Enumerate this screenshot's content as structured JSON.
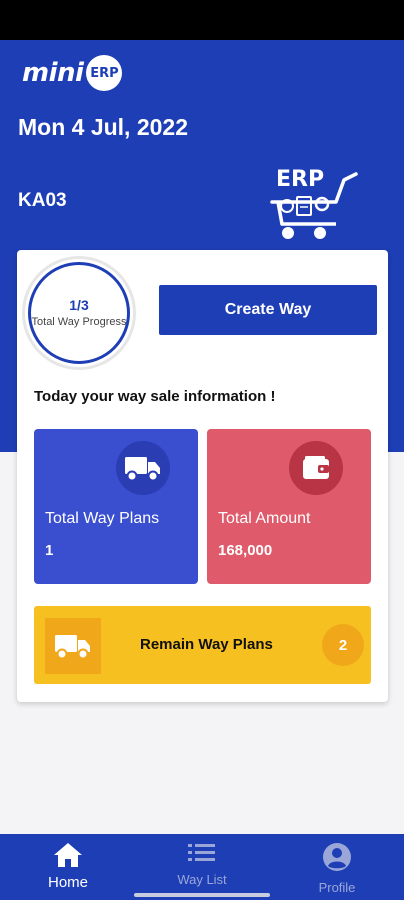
{
  "app": {
    "logo_text": "mini",
    "logo_badge": "ERP"
  },
  "header": {
    "date": "Mon 4 Jul, 2022",
    "code": "KA03",
    "illustration_text": "ERP",
    "colors": {
      "primary": "#1e3eb6"
    }
  },
  "progress": {
    "value": "1/3",
    "label": "Total Way Progress",
    "fraction": 0.333
  },
  "actions": {
    "create_way_label": "Create Way"
  },
  "info": {
    "title": "Today your way sale information !"
  },
  "tiles": [
    {
      "label": "Total Way Plans",
      "value": "1",
      "icon": "truck-icon",
      "color": "#3a4ed0"
    },
    {
      "label": "Total Amount",
      "value": "168,000",
      "icon": "wallet-icon",
      "color": "#df5b6b"
    }
  ],
  "remain": {
    "label": "Remain Way Plans",
    "count": "2",
    "icon": "truck-icon",
    "color": "#f5c020"
  },
  "bottom_nav": {
    "items": [
      {
        "label": "Home",
        "icon": "home-icon",
        "active": true
      },
      {
        "label": "Way List",
        "icon": "list-icon",
        "active": false
      },
      {
        "label": "Profile",
        "icon": "account-circle-icon",
        "active": false
      }
    ]
  }
}
